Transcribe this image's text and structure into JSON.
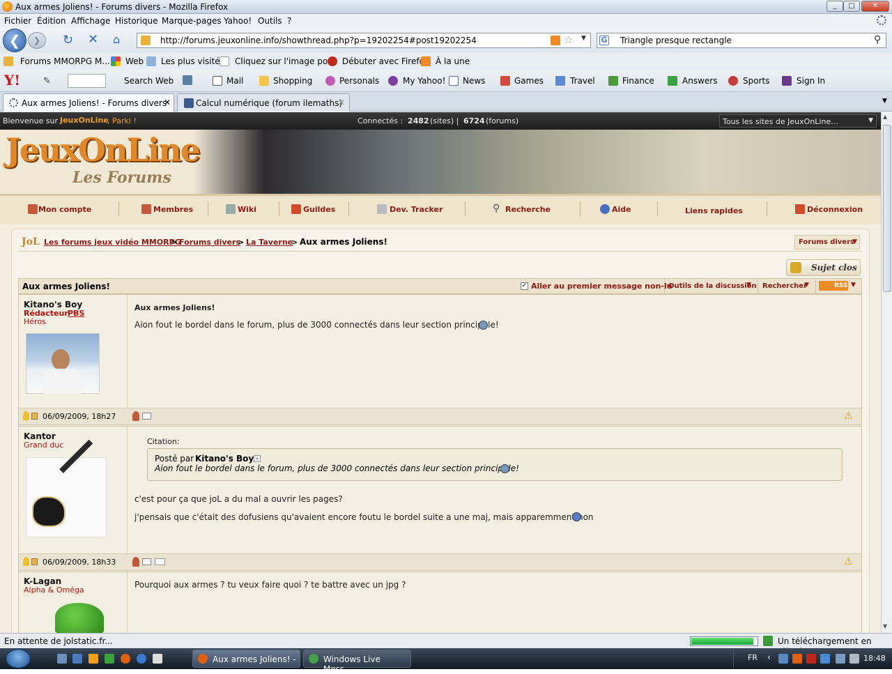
{
  "window": {
    "title": "Aux armes Joliens! - Forums divers - Mozilla Firefox",
    "min": "0",
    "max": "1",
    "close": "r"
  },
  "menu": [
    "Fichier",
    "Édition",
    "Affichage",
    "Historique",
    "Marque-pages",
    "Yahoo!",
    "Outils",
    "?"
  ],
  "nav": {
    "url": "http://forums.jeuxonline.info/showthread.php?p=19202254#post19202254",
    "search": "Triangle presque rectangle"
  },
  "bookmarks": [
    "Forums MMORPG M...",
    "Web",
    "Les plus visités",
    "Cliquez sur l'image po...",
    "Débuter avec Firefox",
    "À la une"
  ],
  "yahoo": {
    "logo": "Y!",
    "items": [
      "Search Web",
      "Mail",
      "Shopping",
      "Personals",
      "My Yahoo!",
      "News",
      "Games",
      "Travel",
      "Finance",
      "Answers",
      "Sports",
      "Sign In"
    ]
  },
  "tabs": [
    {
      "label": "Aux armes Joliens! - Forums divers",
      "active": true
    },
    {
      "label": "Calcul numérique (forum ilemaths)",
      "active": false
    }
  ],
  "site": {
    "welcome": "Bienvenue sur",
    "brand": "JeuxOnLine",
    "user": ", Parki !",
    "connected_label": "Connectés :",
    "connected_sites": "2482",
    "sites_label": "(sites) |",
    "connected_forums": "6724",
    "forums_label": "(forums)",
    "all_sites": "Tous les sites de JeuxOnLine...",
    "logo_main": "JeuxOnLine",
    "logo_sub": "Les Forums",
    "nav": [
      "Mon compte",
      "Membres",
      "Wiki",
      "Guildes",
      "Dev. Tracker",
      "Recherche",
      "Aide",
      "Liens rapides",
      "Déconnexion"
    ],
    "breadcrumb": {
      "a": "Les forums jeux vidéo MMORPG",
      "b": "Forums divers",
      "c": "La Taverne",
      "current": "Aux armes Joliens!",
      "sep": ">"
    },
    "forum_jump": "Forums divers",
    "closed_btn": "Sujet clos",
    "thread_title": "Aux armes Joliens!",
    "thread_tools": {
      "first_unread": "Aller au premier message non-lu",
      "tools": "Outils de la discussion",
      "search": "Rechercher",
      "rss": "RSS"
    }
  },
  "posts": [
    {
      "user": "Kitano's Boy",
      "rank1": "Rédacteur",
      "rank1b": "PBS",
      "rank2": "Héros",
      "title": "Aux armes Joliens!",
      "body": "Aion fout le bordel dans le forum, plus de 3000 connectés dans leur section principale!",
      "date": "06/09/2009, 18h27"
    },
    {
      "user": "Kantor",
      "rank2": "Grand duc",
      "quote_label": "Citation:",
      "quote_by_label": "Posté par",
      "quote_by": "Kitano's Boy",
      "quote_text": "Aion fout le bordel dans le forum, plus de 3000 connectés dans leur section principale!",
      "body1": "c'est pour ça que joL a du mal a ouvrir les pages?",
      "body2": "j'pensais que c'était des dofusiens qu'avaient encore foutu le bordel suite a une maj, mais apparemment non",
      "date": "06/09/2009, 18h33"
    },
    {
      "user": "K-Lagan",
      "rank2": "Alpha & Oméga",
      "body": "Pourquoi aux armes ? tu veux faire quoi ? te battre avec un jpg ?"
    }
  ],
  "status": {
    "left": "En attente de jolstatic.fr...",
    "right": "Un téléchargement en attente",
    "progress": 0.95
  },
  "taskbar": {
    "tasks": [
      "Aux armes Joliens! - ...",
      "Windows Live Mess..."
    ],
    "lang": "FR",
    "clock": "18:48"
  },
  "colors": {
    "link": "#8c1a12",
    "rank": "#b5120b",
    "page_bg": "#f4eee1"
  }
}
